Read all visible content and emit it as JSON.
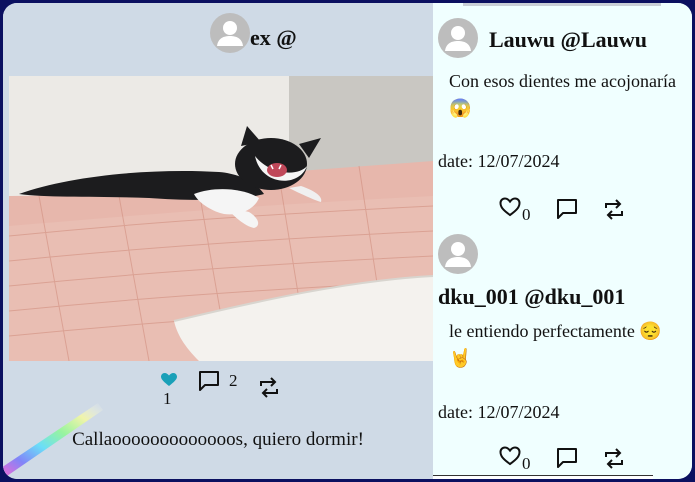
{
  "post": {
    "handle": "ex @",
    "likes": "1",
    "comments": "2",
    "caption": "Callaooooooooooooos, quiero dormir!"
  },
  "comments": [
    {
      "handle": "Lauwu @Lauwu",
      "text": "Con esos dientes me acojonaría 😱",
      "date": "date: 12/07/2024",
      "likes": "0"
    },
    {
      "handle": "dku_001 @dku_001",
      "text": "le entiendo perfectamente 😔 🤘",
      "date": "date: 12/07/2024",
      "likes": "0"
    }
  ],
  "colors": {
    "accent_like": "#1aa0b8",
    "panel_left": "#cfdae6",
    "panel_right": "#f0ffff",
    "background": "#0b1060"
  }
}
